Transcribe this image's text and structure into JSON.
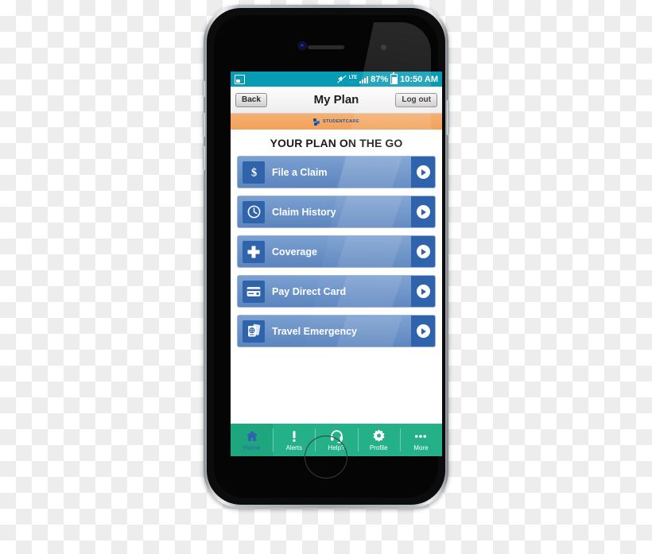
{
  "device": {
    "type": "smartphone-mockup",
    "frame_color": "#a3a7ab",
    "screen_bg": "#ffffff"
  },
  "status_bar": {
    "background": "#089bb4",
    "gallery_icon": "gallery-icon",
    "mute_icon": "volume-mute-icon",
    "network_type": "LTE",
    "network_sub": "...",
    "signal_icon": "signal-bars-icon",
    "battery_percent": "87%",
    "battery_icon": "battery-icon",
    "clock": "10:50 AM"
  },
  "nav_bar": {
    "back_label": "Back",
    "title": "My Plan",
    "logout_label": "Log out"
  },
  "brand_banner": {
    "logo_icon": "studentcare-logo-icon",
    "name": "STUDENTCARE",
    "background": "#f2a15c",
    "text_color": "#1a4f9c"
  },
  "headline": "YOUR PLAN ON THE GO",
  "menu": {
    "accent": "#2f63ab",
    "items": [
      {
        "label": "File a Claim",
        "icon": "dollar-sign-icon",
        "arrow": "chevron-right-icon"
      },
      {
        "label": "Claim History",
        "icon": "clock-icon",
        "arrow": "chevron-right-icon"
      },
      {
        "label": "Coverage",
        "icon": "medical-cross-icon",
        "arrow": "chevron-right-icon"
      },
      {
        "label": "Pay Direct Card",
        "icon": "credit-card-icon",
        "arrow": "chevron-right-icon"
      },
      {
        "label": "Travel Emergency",
        "icon": "passport-ticket-icon",
        "arrow": "chevron-right-icon"
      }
    ]
  },
  "tab_bar": {
    "background": "#24b189",
    "active_background": "#1ea67e",
    "active_color": "#2f63ab",
    "tabs": [
      {
        "label": "Home",
        "icon": "home-icon",
        "active": true
      },
      {
        "label": "Alerts",
        "icon": "exclamation-icon",
        "active": false
      },
      {
        "label": "Help?",
        "icon": "headset-icon",
        "active": false
      },
      {
        "label": "Profile",
        "icon": "gear-icon",
        "active": false
      },
      {
        "label": "More",
        "icon": "ellipsis-icon",
        "active": false
      }
    ]
  }
}
